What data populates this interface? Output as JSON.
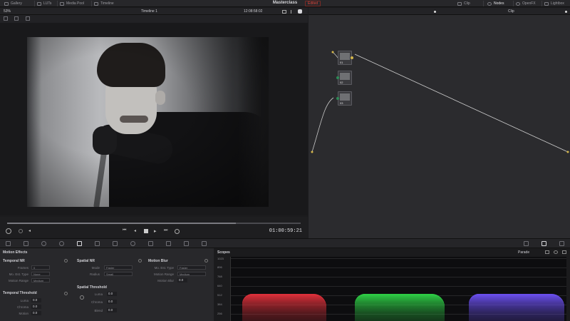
{
  "menubar": {
    "items": [
      "Gallery",
      "LUTs",
      "Media Pool",
      "Timeline"
    ],
    "project_title": "Masterclass",
    "edited_badge": "Edited",
    "right_items": [
      "Clip",
      "Nodes",
      "OpenFX",
      "Lightbox"
    ]
  },
  "viewer": {
    "zoom": "53%",
    "timeline_name": "Timeline 1",
    "source_timecode": "12:08:58:02",
    "current_timecode": "01:00:59:21",
    "progress": 0.78
  },
  "node_editor": {
    "mode_label": "Clip",
    "nodes": [
      {
        "id": "01",
        "label": "01"
      },
      {
        "id": "02",
        "label": "02"
      },
      {
        "id": "03",
        "label": "03"
      }
    ]
  },
  "motion_effects": {
    "title": "Motion Effects",
    "temporal_nr": {
      "title": "Temporal NR",
      "rows": [
        {
          "label": "Frames",
          "value": "0"
        },
        {
          "label": "Mo. Est. Type",
          "value": "None"
        },
        {
          "label": "Motion Range",
          "value": "Medium"
        }
      ]
    },
    "temporal_threshold": {
      "title": "Temporal Threshold",
      "rows": [
        {
          "label": "Luma",
          "value": "0.0"
        },
        {
          "label": "Chroma",
          "value": "0.0"
        },
        {
          "label": "Motion",
          "value": "0.0"
        }
      ]
    },
    "spatial_nr": {
      "title": "Spatial NR",
      "rows": [
        {
          "label": "Mode",
          "value": "Faster"
        },
        {
          "label": "Radius",
          "value": "Small"
        }
      ]
    },
    "spatial_threshold": {
      "title": "Spatial Threshold",
      "rows": [
        {
          "label": "Luma",
          "value": "0.0"
        },
        {
          "label": "Chroma",
          "value": "0.0"
        },
        {
          "label": "Blend",
          "value": "0.0"
        }
      ]
    },
    "motion_blur": {
      "title": "Motion Blur",
      "rows": [
        {
          "label": "Mo. Est. Type",
          "value": "Faster"
        },
        {
          "label": "Motion Range",
          "value": "Medium"
        },
        {
          "label": "Motion Blur",
          "value": "0.0"
        }
      ]
    }
  },
  "scopes": {
    "title": "Scopes",
    "mode": "Parade",
    "y_labels": [
      "1023",
      "896",
      "768",
      "640",
      "512",
      "384",
      "256"
    ],
    "colors": {
      "red": "#e0303a",
      "green": "#2ed045",
      "blue": "#6b4ff0"
    }
  }
}
